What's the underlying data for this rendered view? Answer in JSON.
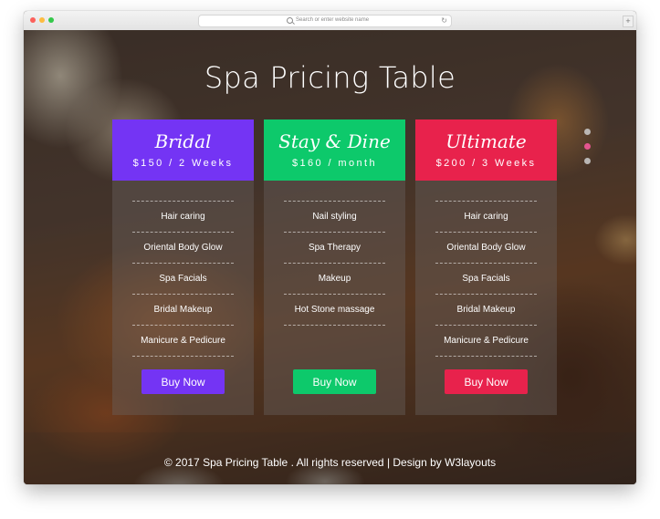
{
  "browser": {
    "url_placeholder": "Search or enter website name",
    "reload_glyph": "↻",
    "new_tab_glyph": "+"
  },
  "page": {
    "title": "Spa Pricing Table",
    "footer": "© 2017 Spa Pricing Table . All rights reserved | Design by W3layouts"
  },
  "plans": [
    {
      "name": "Bridal",
      "price": "$150 / 2 Weeks",
      "color": "#7434f4",
      "features": [
        "Hair caring",
        "Oriental Body Glow",
        "Spa Facials",
        "Bridal Makeup",
        "Manicure & Pedicure"
      ],
      "button": "Buy Now"
    },
    {
      "name": "Stay & Dine",
      "price": "$160 / month",
      "color": "#0dc96b",
      "features": [
        "Nail styling",
        "Spa Therapy",
        "Makeup",
        "Hot Stone massage"
      ],
      "button": "Buy Now"
    },
    {
      "name": "Ultimate",
      "price": "$200 / 3 Weeks",
      "color": "#e8224c",
      "features": [
        "Hair caring",
        "Oriental Body Glow",
        "Spa Facials",
        "Bridal Makeup",
        "Manicure & Pedicure"
      ],
      "button": "Buy Now"
    }
  ],
  "slider": {
    "count": 3,
    "active_index": 1,
    "active_color": "#e4558f"
  },
  "icons": {
    "search": "search-icon",
    "reload": "reload-icon",
    "close": "close-window-icon",
    "minimize": "minimize-window-icon",
    "zoom": "zoom-window-icon"
  }
}
